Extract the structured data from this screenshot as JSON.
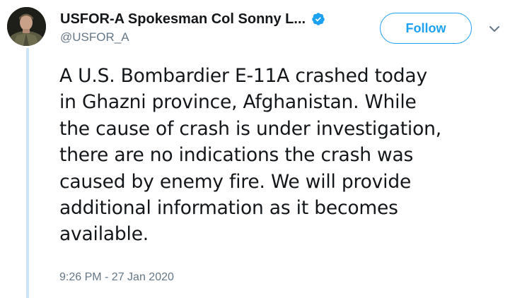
{
  "author": {
    "display_name": "USFOR-A Spokesman Col Sonny L...",
    "handle": "@USFOR_A",
    "verified": true
  },
  "actions": {
    "follow_label": "Follow",
    "menu_icon": "chevron-down-icon"
  },
  "tweet": {
    "text": "A U.S. Bombardier E-11A crashed today\nin Ghazni province, Afghanistan. While\nthe cause of crash is under investigation,\nthere are no indications the crash was\ncaused by enemy fire. We will provide\nadditional information as it becomes\navailable.",
    "timestamp": "9:26 PM - 27 Jan 2020"
  },
  "colors": {
    "accent": "#1da1f2",
    "thread_line": "#cde6f7",
    "secondary_text": "#657786",
    "primary_text": "#14171a"
  }
}
